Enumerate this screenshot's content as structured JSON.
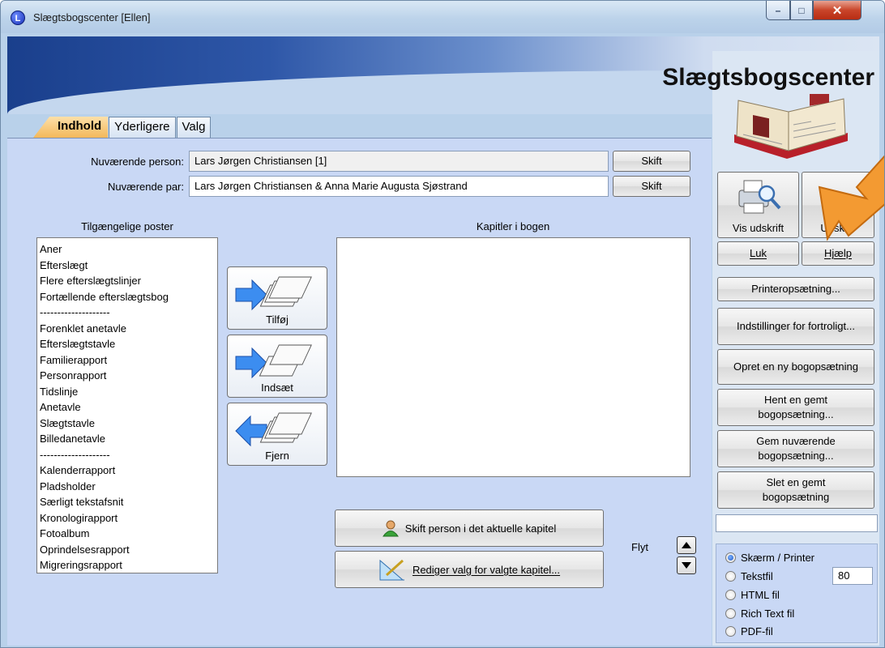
{
  "window": {
    "title": "Slægtsbogscenter [Ellen]",
    "app_heading": "Slægtsbogscenter",
    "icon_letter": "L"
  },
  "tabs": [
    {
      "label": "Indhold",
      "active": true
    },
    {
      "label": "Yderligere",
      "active": false
    },
    {
      "label": "Valg",
      "active": false
    }
  ],
  "person": {
    "label": "Nuværende person:",
    "value": "Lars Jørgen Christiansen [1]",
    "button": "Skift"
  },
  "couple": {
    "label": "Nuværende par:",
    "value": "Lars Jørgen Christiansen & Anna Marie Augusta Sjøstrand",
    "button": "Skift"
  },
  "available": {
    "label": "Tilgængelige poster",
    "items": [
      "Aner",
      "Efterslægt",
      "Flere efterslægtslinjer",
      "Fortællende efterslægtsbog",
      "--------------------",
      "Forenklet anetavle",
      "Efterslægtstavle",
      "Familierapport",
      "Personrapport",
      "Tidslinje",
      "Anetavle",
      "Slægtstavle",
      "Billedanetavle",
      "--------------------",
      "Kalenderrapport",
      "Pladsholder",
      "Særligt tekstafsnit",
      "Kronologirapport",
      "Fotoalbum",
      "Oprindelsesrapport",
      "Migreringsrapport"
    ]
  },
  "actions": {
    "add": "Tilføj",
    "insert": "Indsæt",
    "remove": "Fjern"
  },
  "chapters": {
    "label": "Kapitler i bogen"
  },
  "bottom": {
    "change_person": "Skift person i det aktuelle kapitel",
    "edit_options": "Rediger valg for valgte kapitel...",
    "move_label": "Flyt"
  },
  "right": {
    "preview": "Vis udskrift",
    "print": "Udskriv",
    "close": "Luk",
    "help": "Hjælp",
    "printer_setup": "Printeropsætning...",
    "privacy": "Indstillinger for fortroligt...",
    "new_setup": "Opret en ny bogopsætning",
    "load_setup": [
      "Hent en gemt",
      "bogopsætning..."
    ],
    "save_setup": [
      "Gem nuværende",
      "bogopsætning..."
    ],
    "delete_setup": [
      "Slet en gemt",
      "bogopsætning"
    ]
  },
  "output": {
    "options": [
      {
        "label": "Skærm / Printer",
        "selected": true
      },
      {
        "label": "Tekstfil",
        "selected": false
      },
      {
        "label": "HTML fil",
        "selected": false
      },
      {
        "label": "Rich Text fil",
        "selected": false
      },
      {
        "label": "PDF-fil",
        "selected": false
      }
    ],
    "width_value": "80"
  }
}
